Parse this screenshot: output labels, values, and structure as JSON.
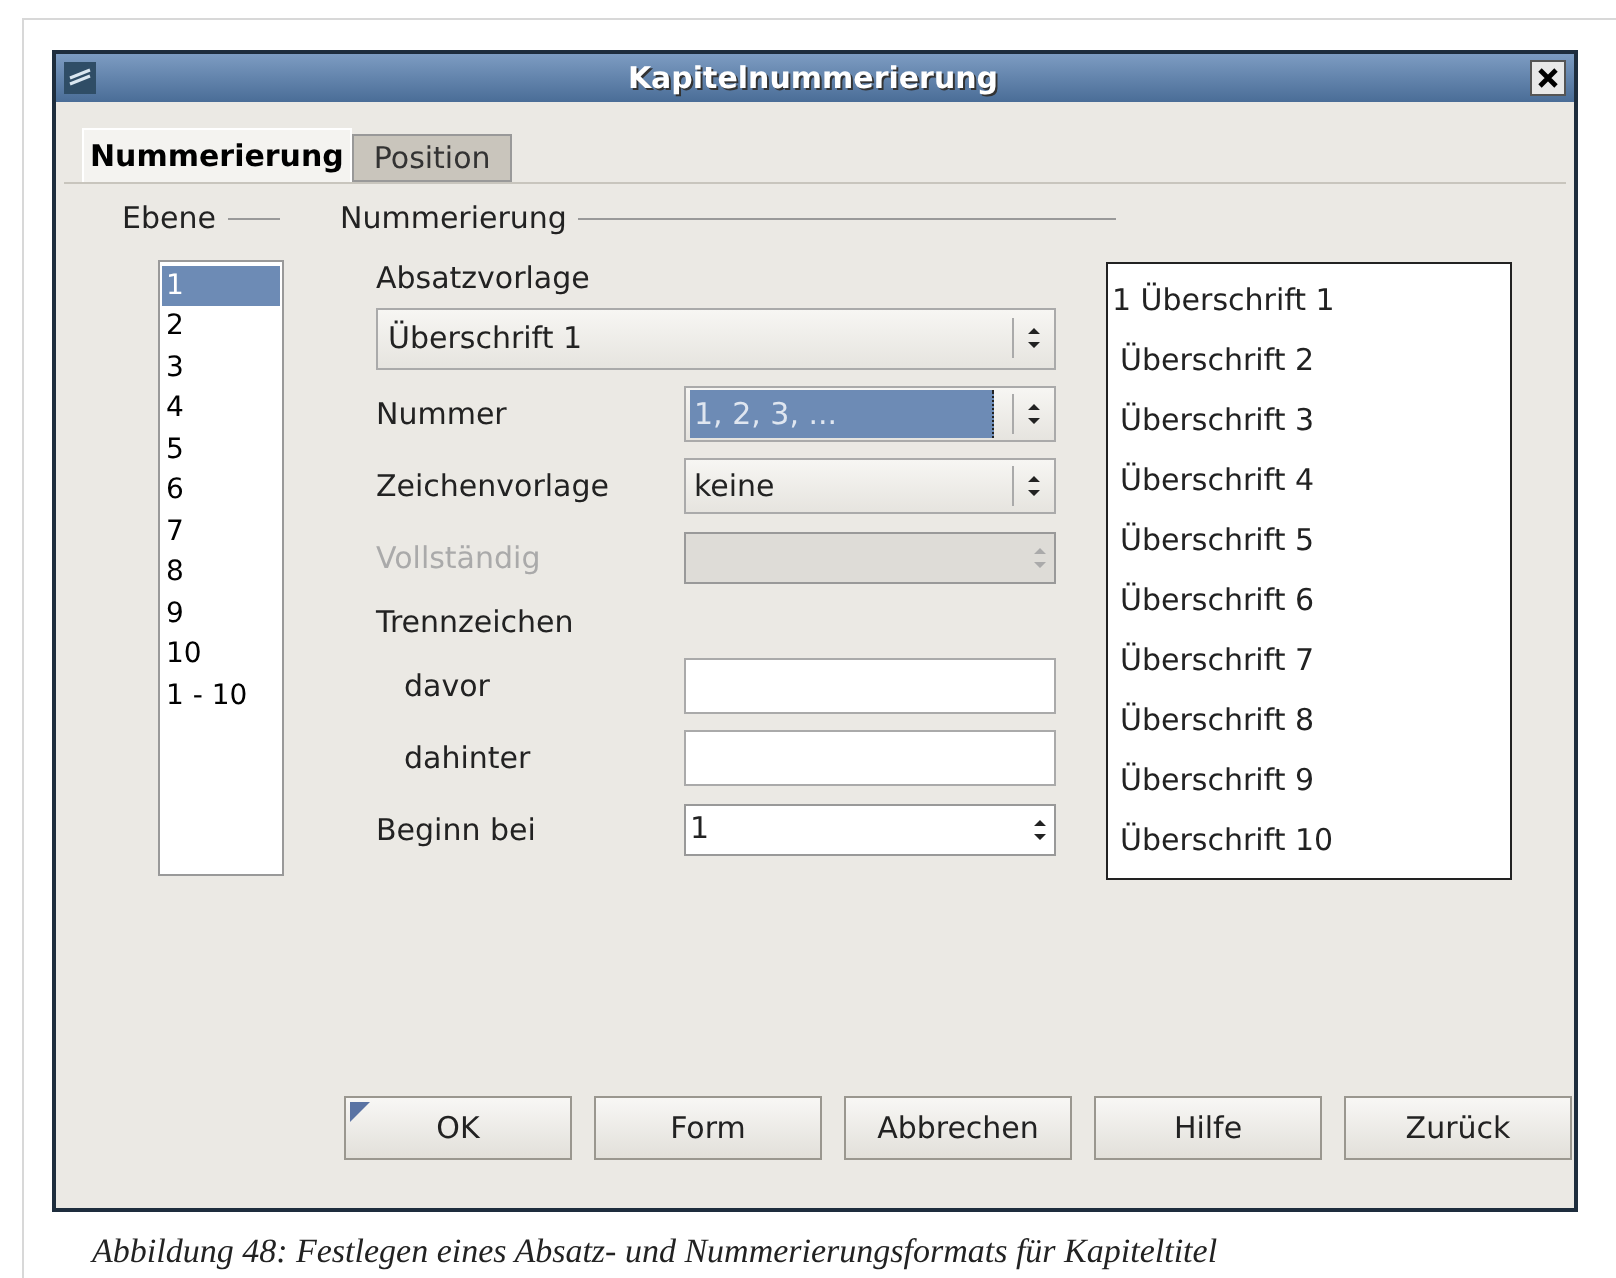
{
  "window": {
    "title": "Kapitelnummerierung"
  },
  "tabs": [
    {
      "label": "Nummerierung",
      "selected": true
    },
    {
      "label": "Position",
      "selected": false
    }
  ],
  "levels": {
    "title": "Ebene",
    "items": [
      {
        "label": "1",
        "selected": true
      },
      {
        "label": "2",
        "selected": false
      },
      {
        "label": "3",
        "selected": false
      },
      {
        "label": "4",
        "selected": false
      },
      {
        "label": "5",
        "selected": false
      },
      {
        "label": "6",
        "selected": false
      },
      {
        "label": "7",
        "selected": false
      },
      {
        "label": "8",
        "selected": false
      },
      {
        "label": "9",
        "selected": false
      },
      {
        "label": "10",
        "selected": false
      },
      {
        "label": "1 - 10",
        "selected": false
      }
    ]
  },
  "numbering": {
    "title": "Nummerierung",
    "paragraph_style": {
      "label": "Absatzvorlage",
      "value": "Überschrift 1"
    },
    "fields": [
      {
        "kind": "dropdown",
        "label": "Nummer",
        "value": "1, 2, 3, ...",
        "highlighted": true
      },
      {
        "kind": "dropdown",
        "label": "Zeichenvorlage",
        "value": "keine",
        "highlighted": false
      },
      {
        "kind": "spin",
        "label": "Vollständig",
        "disabled": true
      },
      {
        "kind": "heading",
        "label": "Trennzeichen"
      },
      {
        "kind": "text",
        "label": "davor"
      },
      {
        "kind": "text",
        "label": "dahinter"
      },
      {
        "kind": "spin",
        "label": "Beginn bei",
        "value": "1",
        "disabled": false
      }
    ]
  },
  "preview": {
    "items": [
      "1 Überschrift 1",
      "Überschrift 2",
      "Überschrift 3",
      "Überschrift 4",
      "Überschrift 5",
      "Überschrift 6",
      "Überschrift 7",
      "Überschrift 8",
      "Überschrift 9",
      "Überschrift 10"
    ]
  },
  "buttons": [
    {
      "label": "OK",
      "default": true
    },
    {
      "label": "Form",
      "default": false
    },
    {
      "label": "Abbrechen",
      "default": false
    },
    {
      "label": "Hilfe",
      "default": false
    },
    {
      "label": "Zurück",
      "default": false
    }
  ],
  "caption": "Abbildung 48: Festlegen eines Absatz- und Nummerierungsformats für Kapiteltitel"
}
